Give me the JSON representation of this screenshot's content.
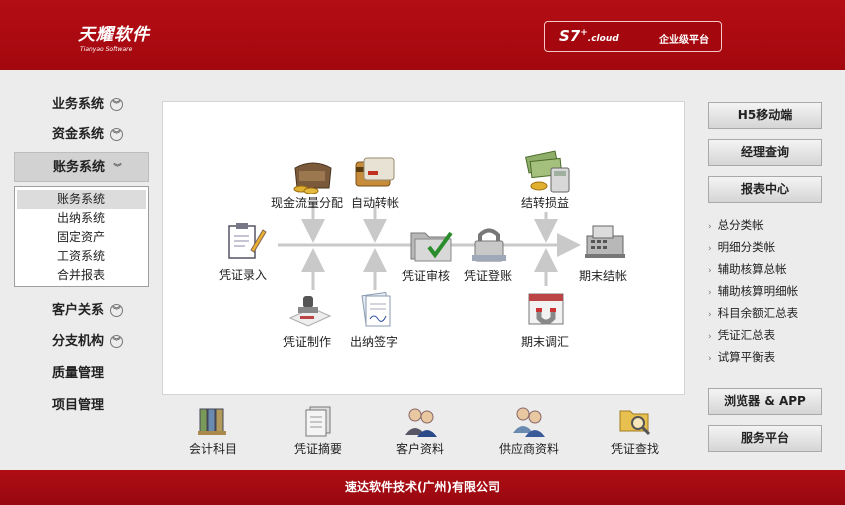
{
  "header": {
    "brand_cn": "天耀软件",
    "brand_en": "Tianyao Software",
    "product": "S7",
    "product_sup": "+",
    "product_suffix": ".cloud",
    "platform": "企业级平台"
  },
  "nav": {
    "items": [
      {
        "label": "业务系统",
        "chevron": true
      },
      {
        "label": "资金系统",
        "chevron": true
      },
      {
        "label": "账务系统",
        "chevron": true,
        "active": true
      },
      {
        "label": "客户关系",
        "chevron": true
      },
      {
        "label": "分支机构",
        "chevron": true
      },
      {
        "label": "质量管理",
        "chevron": false
      },
      {
        "label": "项目管理",
        "chevron": false
      }
    ],
    "submenu": [
      "账务系统",
      "出纳系统",
      "固定资产",
      "工资系统",
      "合并报表"
    ],
    "submenu_selected": "账务系统"
  },
  "flow": {
    "voucher_entry": "凭证录入",
    "cash_flow": "现金流量分配",
    "auto_transfer": "自动转帐",
    "voucher_audit": "凭证审核",
    "voucher_post": "凭证登账",
    "carry_forward": "结转损益",
    "period_close": "期末结帐",
    "voucher_make": "凭证制作",
    "cashier_sign": "出纳签字",
    "period_adjust": "期末调汇"
  },
  "tools": [
    "会计科目",
    "凭证摘要",
    "客户资料",
    "供应商资料",
    "凭证查找"
  ],
  "right": {
    "h5": "H5移动端",
    "manager": "经理查询",
    "report_center": "报表中心",
    "reports": [
      "总分类帐",
      "明细分类帐",
      "辅助核算总帐",
      "辅助核算明细帐",
      "科目余额汇总表",
      "凭证汇总表",
      "试算平衡表"
    ],
    "browser_app": "浏览器 & APP",
    "service": "服务平台"
  },
  "footer": "速达软件技术(广州)有限公司",
  "colors": {
    "header": "#b40d14",
    "footer": "#a00a11",
    "background": "#ececec"
  },
  "icons": {
    "nav_chevron": "double-chevron-down-icon",
    "voucher_entry": "clipboard-pencil-icon",
    "cash_flow": "wallet-coins-icon",
    "auto_transfer": "card-icon",
    "voucher_audit": "folders-check-icon",
    "voucher_post": "padlock-icon",
    "carry_forward": "money-calculator-icon",
    "period_close": "cash-register-icon",
    "voucher_make": "stamp-icon",
    "cashier_sign": "signed-document-icon",
    "period_adjust": "calendar-magnet-icon"
  }
}
